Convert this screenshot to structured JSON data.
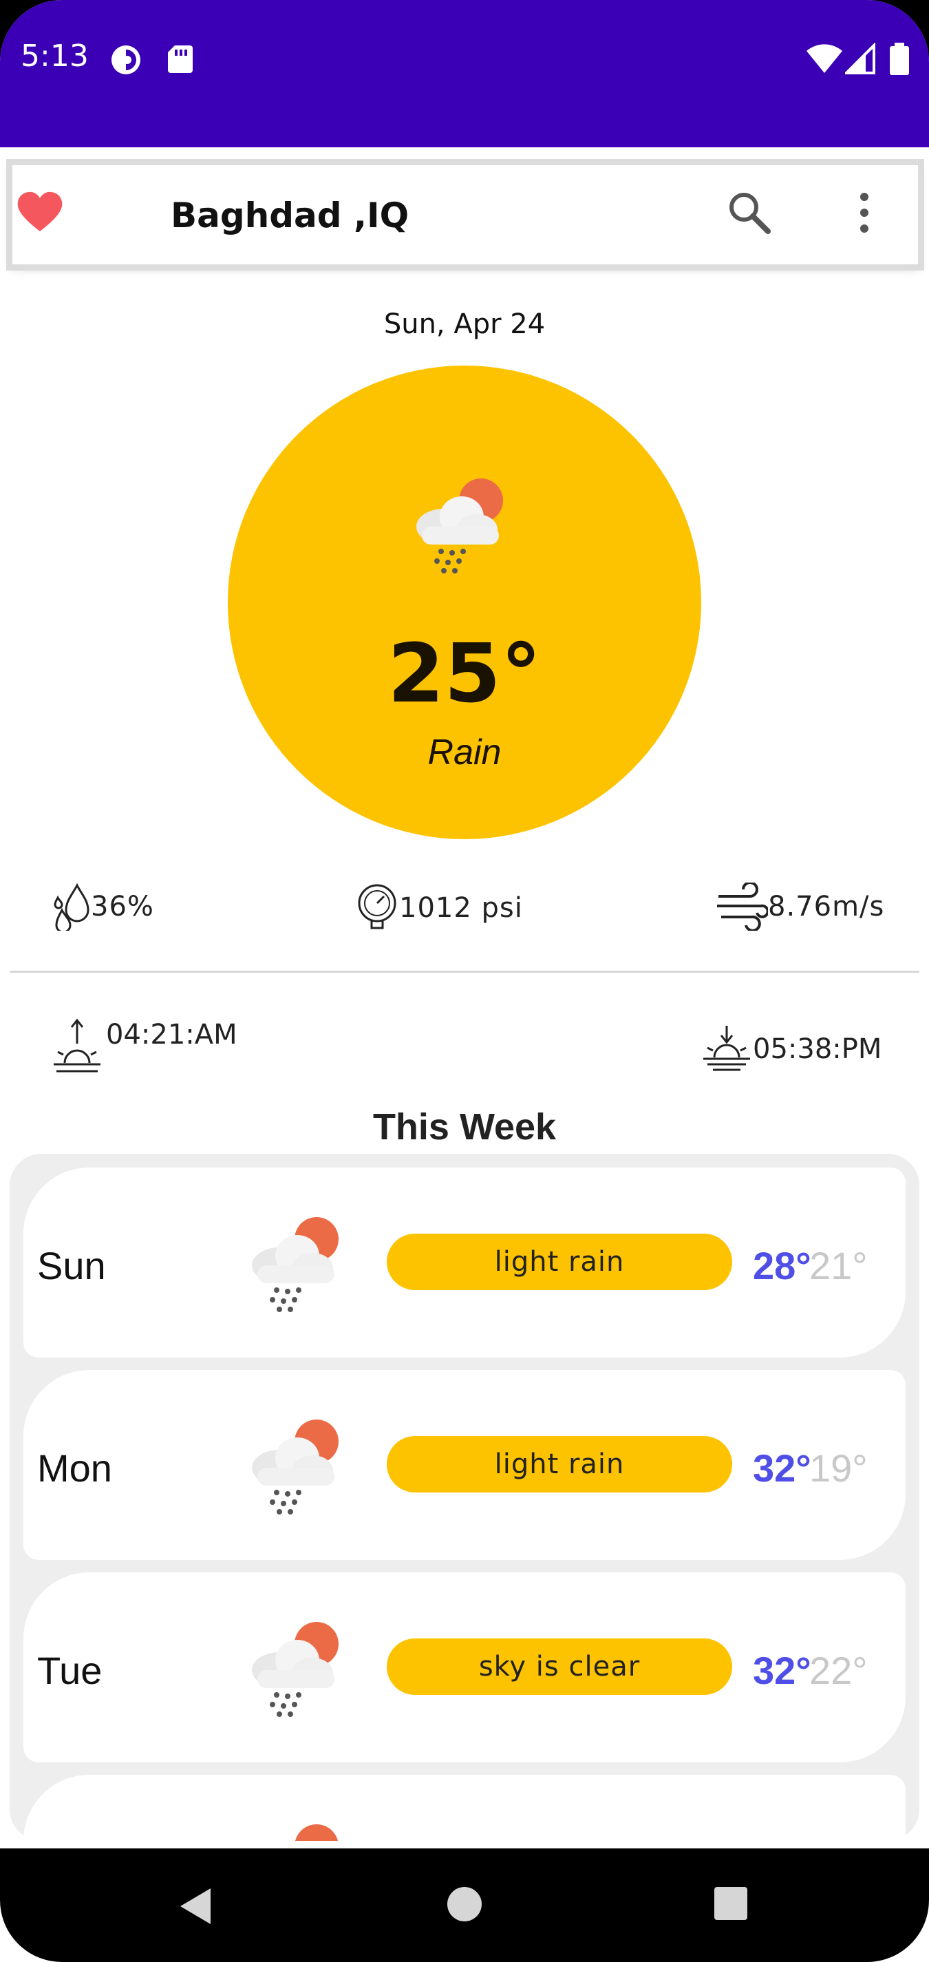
{
  "status_bar": {
    "time": "5:13",
    "bg_color": "#3b00b5",
    "icons": [
      "data-saver-icon",
      "sd-card-icon",
      "wifi-icon",
      "signal-icon",
      "battery-icon"
    ]
  },
  "app_bar": {
    "city": "Baghdad ,IQ",
    "favorite_icon": "heart-icon",
    "search_icon": "search-icon",
    "menu_icon": "more-vert-icon",
    "heart_color": "#f4575d"
  },
  "current": {
    "date": "Sun, Apr 24",
    "temperature": "25°",
    "condition": "Rain",
    "icon": "cloud-sun-rain-icon",
    "circle_color": "#fdc300"
  },
  "stats": {
    "humidity": "36%",
    "pressure": "1012 psi",
    "wind": "8.76m/s"
  },
  "sun": {
    "sunrise": "04:21:AM",
    "sunset": "05:38:PM"
  },
  "week": {
    "title": "This Week",
    "days": [
      {
        "day": "Sun",
        "description": "light rain",
        "high": "28°",
        "low": "21°"
      },
      {
        "day": "Mon",
        "description": "light rain",
        "high": "32°",
        "low": "19°"
      },
      {
        "day": "Tue",
        "description": "sky is clear",
        "high": "32°",
        "low": "22°"
      }
    ]
  },
  "colors": {
    "accent": "#fdc300",
    "high_temp": "#4f4fe8",
    "low_temp": "#c8c8c8"
  }
}
